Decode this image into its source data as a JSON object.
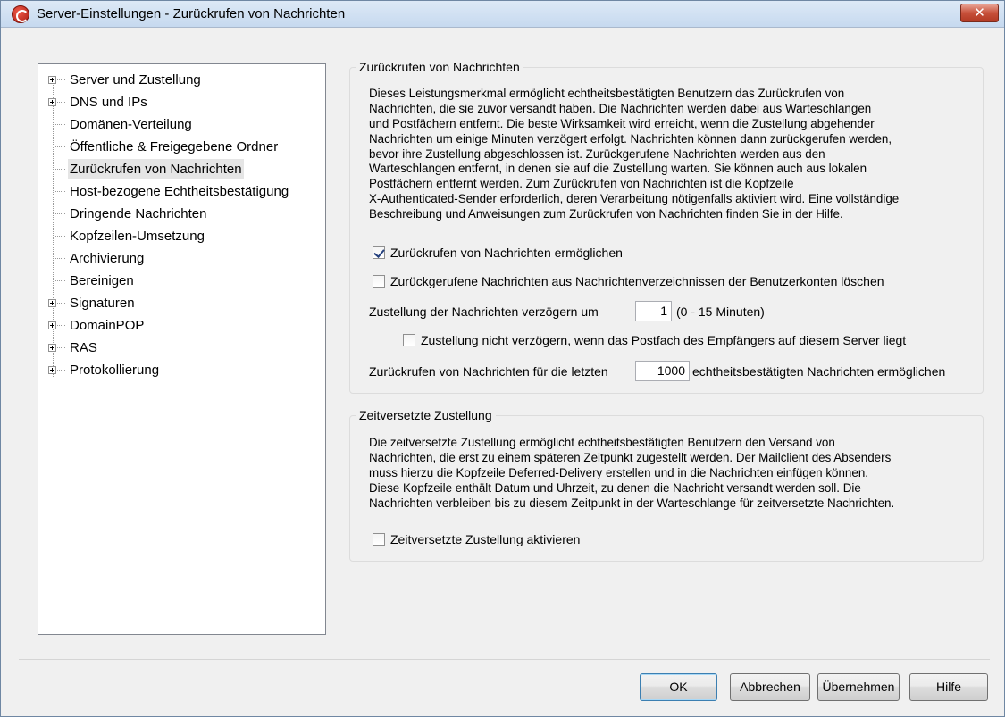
{
  "window": {
    "title": "Server-Einstellungen - Zurückrufen von Nachrichten",
    "close_label": "✕"
  },
  "tree": {
    "items": [
      {
        "label": "Server und Zustellung",
        "expandable": true
      },
      {
        "label": "DNS und IPs",
        "expandable": true
      },
      {
        "label": "Domänen-Verteilung",
        "expandable": false
      },
      {
        "label": "Öffentliche & Freigegebene Ordner",
        "expandable": false
      },
      {
        "label": "Zurückrufen von Nachrichten",
        "expandable": false,
        "selected": true
      },
      {
        "label": "Host-bezogene Echtheitsbestätigung",
        "expandable": false
      },
      {
        "label": "Dringende Nachrichten",
        "expandable": false
      },
      {
        "label": "Kopfzeilen-Umsetzung",
        "expandable": false
      },
      {
        "label": "Archivierung",
        "expandable": false
      },
      {
        "label": "Bereinigen",
        "expandable": false
      },
      {
        "label": "Signaturen",
        "expandable": true
      },
      {
        "label": "DomainPOP",
        "expandable": true
      },
      {
        "label": "RAS",
        "expandable": true
      },
      {
        "label": "Protokollierung",
        "expandable": true
      }
    ]
  },
  "recall": {
    "title": "Zurückrufen von Nachrichten",
    "description": [
      "Dieses Leistungsmerkmal ermöglicht echtheitsbestätigten Benutzern das Zurückrufen von",
      "Nachrichten, die sie zuvor versandt haben. Die Nachrichten werden dabei aus Warteschlangen",
      "und Postfächern entfernt. Die beste Wirksamkeit wird erreicht, wenn die Zustellung abgehender",
      "Nachrichten um einige Minuten verzögert erfolgt. Nachrichten können dann zurückgerufen werden,",
      "bevor ihre Zustellung abgeschlossen ist. Zurückgerufene Nachrichten werden aus den",
      "Warteschlangen entfernt, in denen sie auf die Zustellung warten. Sie können auch aus lokalen",
      "Postfächern entfernt werden. Zum Zurückrufen von Nachrichten ist die Kopfzeile",
      "X-Authenticated-Sender erforderlich, deren Verarbeitung nötigenfalls aktiviert wird. Eine vollständige",
      "Beschreibung und Anweisungen zum Zurückrufen von Nachrichten finden Sie in der Hilfe."
    ],
    "enable_label": "Zurückrufen von Nachrichten ermöglichen",
    "enable_checked": true,
    "delete_label": "Zurückgerufene Nachrichten aus Nachrichtenverzeichnissen der Benutzerkonten löschen",
    "delete_checked": false,
    "delay_label": "Zustellung der Nachrichten verzögern um",
    "delay_value": "1",
    "delay_range": "(0 - 15 Minuten)",
    "no_delay_local_label": "Zustellung nicht verzögern, wenn das Postfach des Empfängers auf diesem Server liegt",
    "no_delay_local_checked": false,
    "last_prefix": "Zurückrufen von Nachrichten für die letzten",
    "last_value": "1000",
    "last_suffix": "echtheitsbestätigten Nachrichten ermöglichen"
  },
  "deferred": {
    "title": "Zeitversetzte Zustellung",
    "description": [
      "Die zeitversetzte Zustellung ermöglicht echtheitsbestätigten Benutzern den Versand von",
      "Nachrichten, die erst zu einem späteren Zeitpunkt zugestellt werden. Der Mailclient des Absenders",
      "muss hierzu die Kopfzeile Deferred-Delivery erstellen und in die Nachrichten einfügen können.",
      "Diese Kopfzeile enthält Datum und Uhrzeit, zu denen die Nachricht versandt werden soll. Die",
      "Nachrichten verbleiben bis zu diesem Zeitpunkt in der Warteschlange für zeitversetzte Nachrichten."
    ],
    "enable_label": "Zeitversetzte Zustellung aktivieren",
    "enable_checked": false
  },
  "buttons": {
    "ok": "OK",
    "cancel": "Abbrechen",
    "apply": "Übernehmen",
    "help": "Hilfe"
  }
}
